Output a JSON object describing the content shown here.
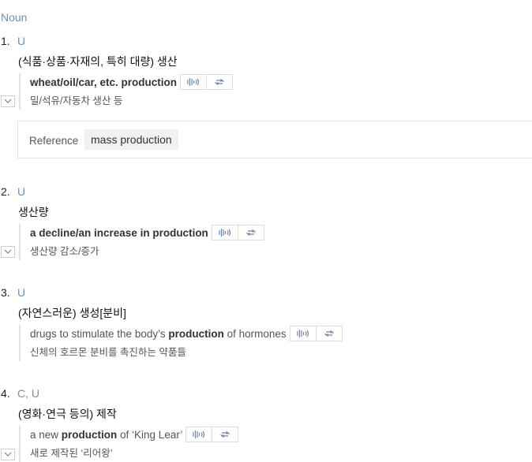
{
  "pos": "Noun",
  "senses": [
    {
      "num": "1.",
      "code": "U",
      "definition": "(식품·상품·자재의, 특히 대량) 생산",
      "example": {
        "en_pre": "",
        "en_bold": "wheat/oil/car, etc. production",
        "en_post": "",
        "ko": "밀/석유/자동차 생산 등"
      },
      "reference": {
        "label": "Reference",
        "term": "mass production"
      }
    },
    {
      "num": "2.",
      "code": "U",
      "definition": "생산량",
      "example": {
        "en_pre": "",
        "en_bold": "a decline/an increase in production",
        "en_post": "",
        "ko": "생산량 감소/증가"
      }
    },
    {
      "num": "3.",
      "code": "U",
      "definition": "(자연스러운) 생성[분비]",
      "example": {
        "en_pre": "drugs to stimulate the body’s ",
        "en_bold": "production",
        "en_post": " of hormones",
        "ko": "신체의 호르몬 분비를 촉진하는 약품들"
      }
    },
    {
      "num": "4.",
      "code": "C, U",
      "definition": "(영화·연극 등의) 제작",
      "example": {
        "en_pre": "a new ",
        "en_bold": "production",
        "en_post": " of ‘King Lear’",
        "ko": "새로 제작된 ‘리어왕’"
      }
    }
  ],
  "icons": {
    "listen": "sound-wave-icon",
    "repeat": "repeat-icon",
    "toggle": "chevron-down-icon"
  },
  "colors": {
    "sense_code": "#6e8fb0",
    "pos_label": "#6e8fb0",
    "border": "#e1e1e1"
  }
}
